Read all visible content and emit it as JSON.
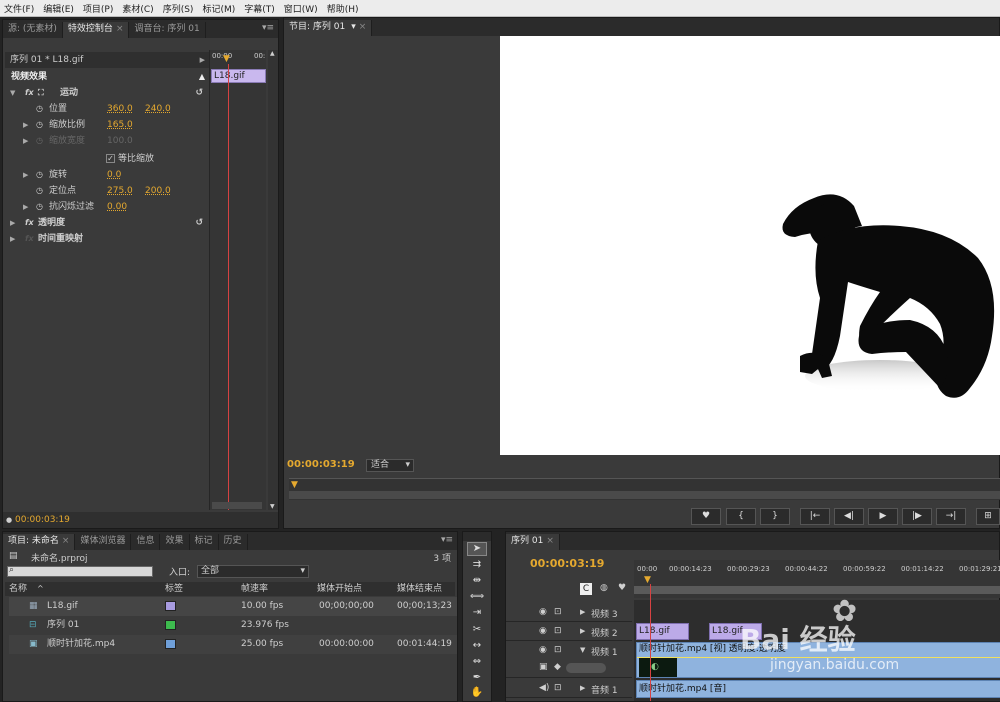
{
  "menubar": [
    "文件(F)",
    "编辑(E)",
    "项目(P)",
    "素材(C)",
    "序列(S)",
    "标记(M)",
    "字幕(T)",
    "窗口(W)",
    "帮助(H)"
  ],
  "source_panel": {
    "tabs": [
      "源: (无素材)",
      "特效控制台",
      "调音台: 序列 01"
    ],
    "menu_icon": "panel-menu-icon",
    "clip_path": "序列 01 * L18.gif",
    "section_title": "视频效果",
    "mini_timeline": {
      "ruler_start": "00:00",
      "ruler_end": "00:",
      "clip_name": "L18.gif"
    },
    "effects": [
      {
        "name": "运动",
        "type": "group"
      },
      {
        "name": "位置",
        "v1": "360.0",
        "v2": "240.0"
      },
      {
        "name": "缩放比例",
        "v1": "165.0"
      },
      {
        "name": "缩放宽度",
        "v1": "100.0",
        "disabled": true
      },
      {
        "name": "等比缩放",
        "checkbox": true
      },
      {
        "name": "旋转",
        "v1": "0.0"
      },
      {
        "name": "定位点",
        "v1": "275.0",
        "v2": "200.0"
      },
      {
        "name": "抗闪烁过滤",
        "v1": "0.00"
      },
      {
        "name": "透明度",
        "type": "group"
      },
      {
        "name": "时间重映射",
        "type": "group"
      }
    ],
    "timecode": "00:00:03:19"
  },
  "program_panel": {
    "tab": "节目: 序列 01",
    "timecode": "00:00:03:19",
    "fit_label": "适合",
    "transport": [
      "♥",
      "{",
      "}",
      "|←",
      "◀|",
      "▶",
      "|▶",
      "→|",
      "⊞"
    ]
  },
  "project_panel": {
    "tabs": [
      "项目: 未命名",
      "媒体浏览器",
      "信息",
      "效果",
      "标记",
      "历史"
    ],
    "project_name": "未命名.prproj",
    "item_count": "3 项",
    "search_placeholder": "",
    "in_label": "入口:",
    "in_value": "全部",
    "columns": [
      "名称",
      "标签",
      "帧速率",
      "媒体开始点",
      "媒体结束点"
    ],
    "rows": [
      {
        "name": "L18.gif",
        "label_color": "#a89be0",
        "fps": "10.00 fps",
        "start": "00;00;00;00",
        "end": "00;00;13;23",
        "icon": "image-file-icon"
      },
      {
        "name": "序列 01",
        "label_color": "#3dba4e",
        "fps": "23.976 fps",
        "start": "",
        "end": "",
        "icon": "sequence-icon"
      },
      {
        "name": "顺时针加花.mp4",
        "label_color": "#6f9fd8",
        "fps": "25.00 fps",
        "start": "00:00:00:00",
        "end": "00:01:44:19",
        "icon": "video-file-icon"
      }
    ]
  },
  "timeline_panel": {
    "tab": "序列 01",
    "timecode": "00:00:03:19",
    "ruler": [
      "00:00",
      "00:00:14:23",
      "00:00:29:23",
      "00:00:44:22",
      "00:00:59:22",
      "00:01:14:22",
      "00:01:29:21"
    ],
    "tracks": [
      {
        "name": "视频 3"
      },
      {
        "name": "视频 2"
      },
      {
        "name": "视频 1"
      },
      {
        "name": "音频 1"
      }
    ],
    "clips": {
      "v2a": "L18.gif",
      "v2b": "L18.gif",
      "v1": "顺时针加花.mp4 [视]  透明度:透明度",
      "a1": "顺时针加花.mp4 [音]"
    }
  },
  "watermark": {
    "brand": "Bai 经验",
    "url": "jingyan.baidu.com"
  }
}
